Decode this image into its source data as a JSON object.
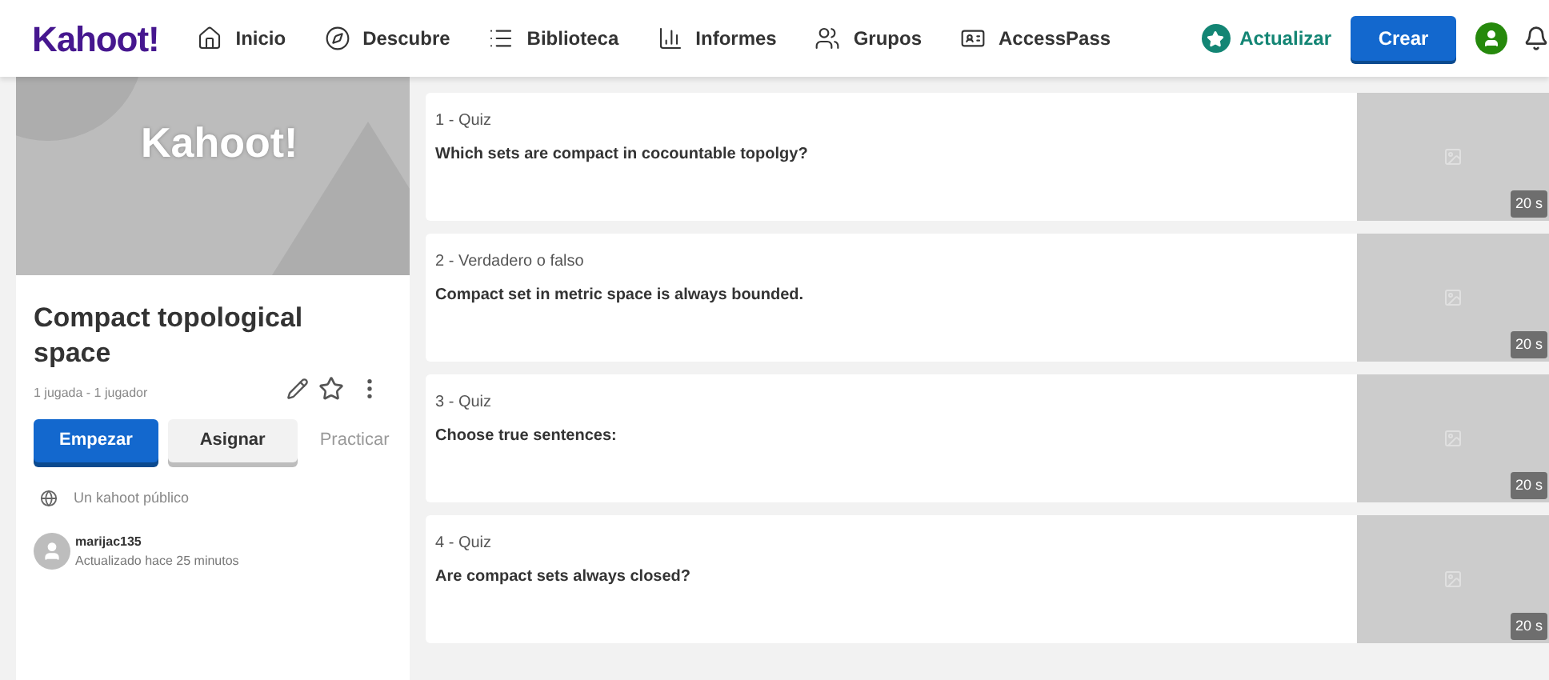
{
  "nav": {
    "logo": "Kahoot!",
    "items": [
      {
        "label": "Inicio",
        "kind": "home"
      },
      {
        "label": "Descubre",
        "kind": "discover"
      },
      {
        "label": "Biblioteca",
        "kind": "library"
      },
      {
        "label": "Informes",
        "kind": "reports"
      },
      {
        "label": "Grupos",
        "kind": "groups"
      },
      {
        "label": "AccessPass",
        "kind": "pass"
      }
    ],
    "upgrade": "Actualizar",
    "create": "Crear"
  },
  "kahoot": {
    "cover_text": "Kahoot!",
    "title": "Compact topological space",
    "stats": "1 jugada - 1 jugador",
    "buttons": [
      {
        "label": "Empezar",
        "kind": "primary"
      },
      {
        "label": "Asignar",
        "kind": "secondary"
      },
      {
        "label": "Practicar",
        "kind": "text"
      }
    ],
    "visibility": "Un kahoot público",
    "author": "marijac135",
    "updated": "Actualizado hace 25 minutos"
  },
  "questions": [
    {
      "type": "1 - Quiz",
      "text": "Which sets are compact in cocountable topolgy?",
      "time": "20 s"
    },
    {
      "type": "2 - Verdadero o falso",
      "text": "Compact set in metric space is always bounded.",
      "time": "20 s"
    },
    {
      "type": "3 - Quiz",
      "text": "Choose true sentences:",
      "time": "20 s"
    },
    {
      "type": "4 - Quiz",
      "text": "Are compact sets always closed?",
      "time": "20 s"
    }
  ]
}
